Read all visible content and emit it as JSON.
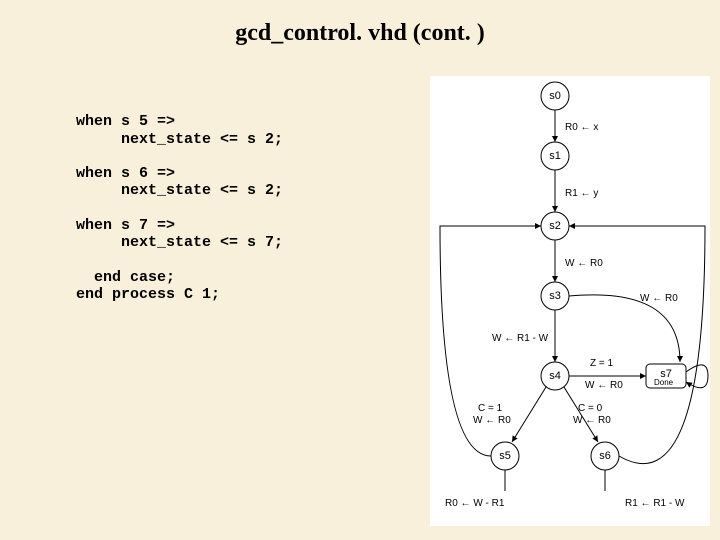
{
  "title": "gcd_control. vhd  (cont. )",
  "code": {
    "w1": "when",
    "s5": " s 5 =>",
    "ns1": "     next_state <= s 2;",
    "w2": "when",
    "s6": " s 6 =>",
    "ns2": "     next_state <= s 2;",
    "w3": "when",
    "s7": " s 7 =>",
    "ns3": "     next_state <= s 7;",
    "ec": "  end case",
    "sc1": ";",
    "ep": "end process",
    "c1": " C 1;"
  },
  "states": {
    "s0": "s0",
    "s1": "s1",
    "s2": "s2",
    "s3": "s3",
    "s4": "s4",
    "s5": "s5",
    "s6": "s6",
    "s7": "s7"
  },
  "edges": {
    "r0x": "R0 ← x",
    "r1y": "R1 ← y",
    "wr0": "W ← R0",
    "wr1w": "W ← R1 - W",
    "z1": "Z = 1",
    "z1b": "W ← R0",
    "c1": "C = 1",
    "c1b": "W ← R0",
    "c0": "C = 0",
    "c0b": "W ← R0",
    "r0wr1": "R0 ← W - R1",
    "r1r1w": "R1 ← R1 - W",
    "wr0l": "W ← R0",
    "done": "Done"
  }
}
